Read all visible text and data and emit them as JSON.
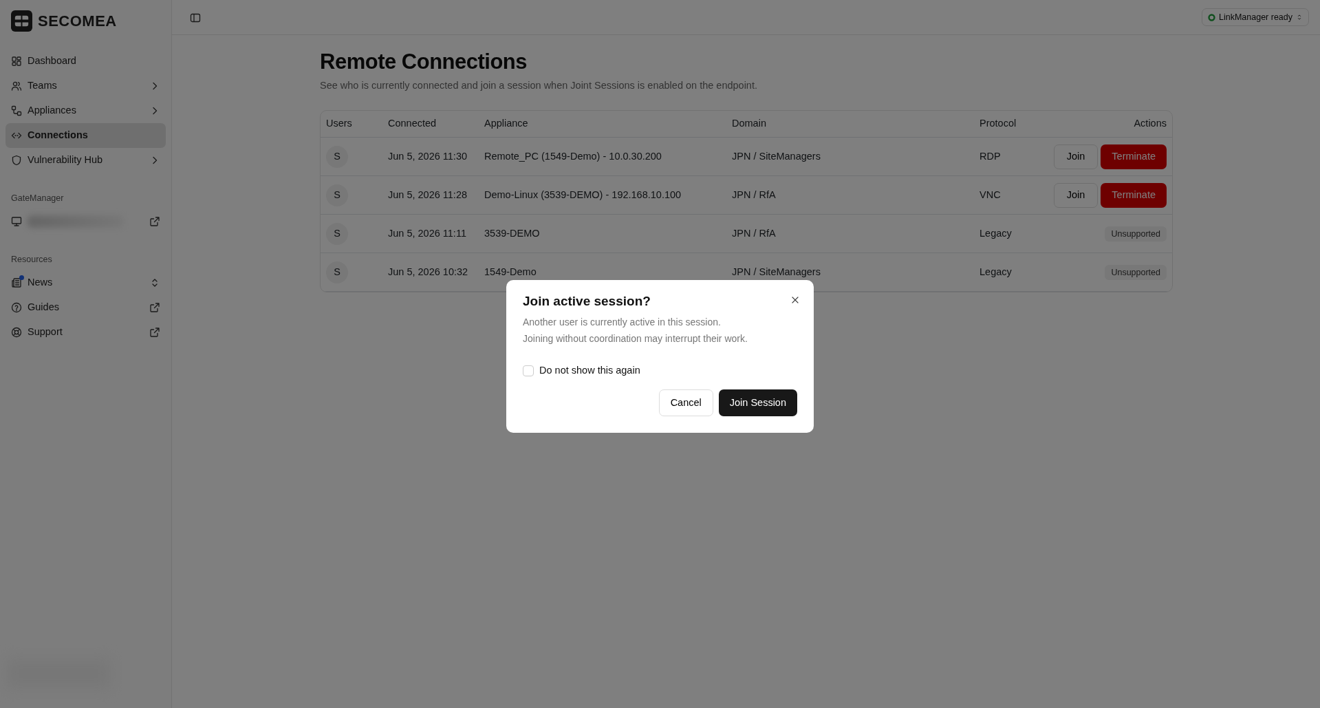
{
  "brand": "SECOMEA",
  "sidebar": {
    "items": [
      {
        "label": "Dashboard",
        "kind": "plain",
        "selected": false
      },
      {
        "label": "Teams",
        "kind": "chevron",
        "selected": false
      },
      {
        "label": "Appliances",
        "kind": "chevron",
        "selected": false
      },
      {
        "label": "Connections",
        "kind": "plain",
        "selected": true
      },
      {
        "label": "Vulnerability Hub",
        "kind": "chevron",
        "selected": false
      }
    ],
    "sections": [
      {
        "title": "GateManager",
        "items": [
          {
            "kind": "external",
            "selected": false
          }
        ]
      },
      {
        "title": "Resources",
        "items": [
          {
            "label": "News",
            "kind": "updown",
            "unread": true,
            "selected": false
          },
          {
            "label": "Guides",
            "kind": "external",
            "selected": false
          },
          {
            "label": "Support",
            "kind": "external",
            "selected": false
          }
        ]
      }
    ]
  },
  "status": {
    "label": "LinkManager ready"
  },
  "page": {
    "title": "Remote Connections",
    "subtitle": "See who is currently connected and join a session when Joint Sessions is enabled on the endpoint."
  },
  "table": {
    "columns": [
      "Users",
      "Connected",
      "Appliance",
      "Domain",
      "Protocol",
      "Actions"
    ],
    "rows": [
      {
        "user": "S",
        "connected": "Jun 5, 2026 11:30",
        "appliance": "Remote_PC (1549-Demo) - 10.0.30.200",
        "domain": "JPN / SiteManagers",
        "protocol": "RDP",
        "actions": {
          "kind": "buttons",
          "join": "Join",
          "terminate": "Terminate"
        }
      },
      {
        "user": "S",
        "connected": "Jun 5, 2026 11:28",
        "appliance": "Demo-Linux (3539-DEMO) - 192.168.10.100",
        "domain": "JPN / RfA",
        "protocol": "VNC",
        "actions": {
          "kind": "buttons",
          "join": "Join",
          "terminate": "Terminate"
        }
      },
      {
        "user": "S",
        "connected": "Jun 5, 2026 11:11",
        "appliance": "3539-DEMO",
        "domain": "JPN / RfA",
        "protocol": "Legacy",
        "actions": {
          "kind": "badge",
          "label": "Unsupported"
        }
      },
      {
        "user": "S",
        "connected": "Jun 5, 2026 10:32",
        "appliance": "1549-Demo",
        "domain": "JPN / SiteManagers",
        "protocol": "Legacy",
        "actions": {
          "kind": "badge",
          "label": "Unsupported"
        }
      }
    ]
  },
  "dialog": {
    "title": "Join active session?",
    "lines": [
      "Another user is currently active in this session.",
      "Joining without coordination may interrupt their work."
    ],
    "checkbox": {
      "label": "Do not show this again",
      "checked": false
    },
    "cancel": "Cancel",
    "confirm": "Join Session"
  }
}
